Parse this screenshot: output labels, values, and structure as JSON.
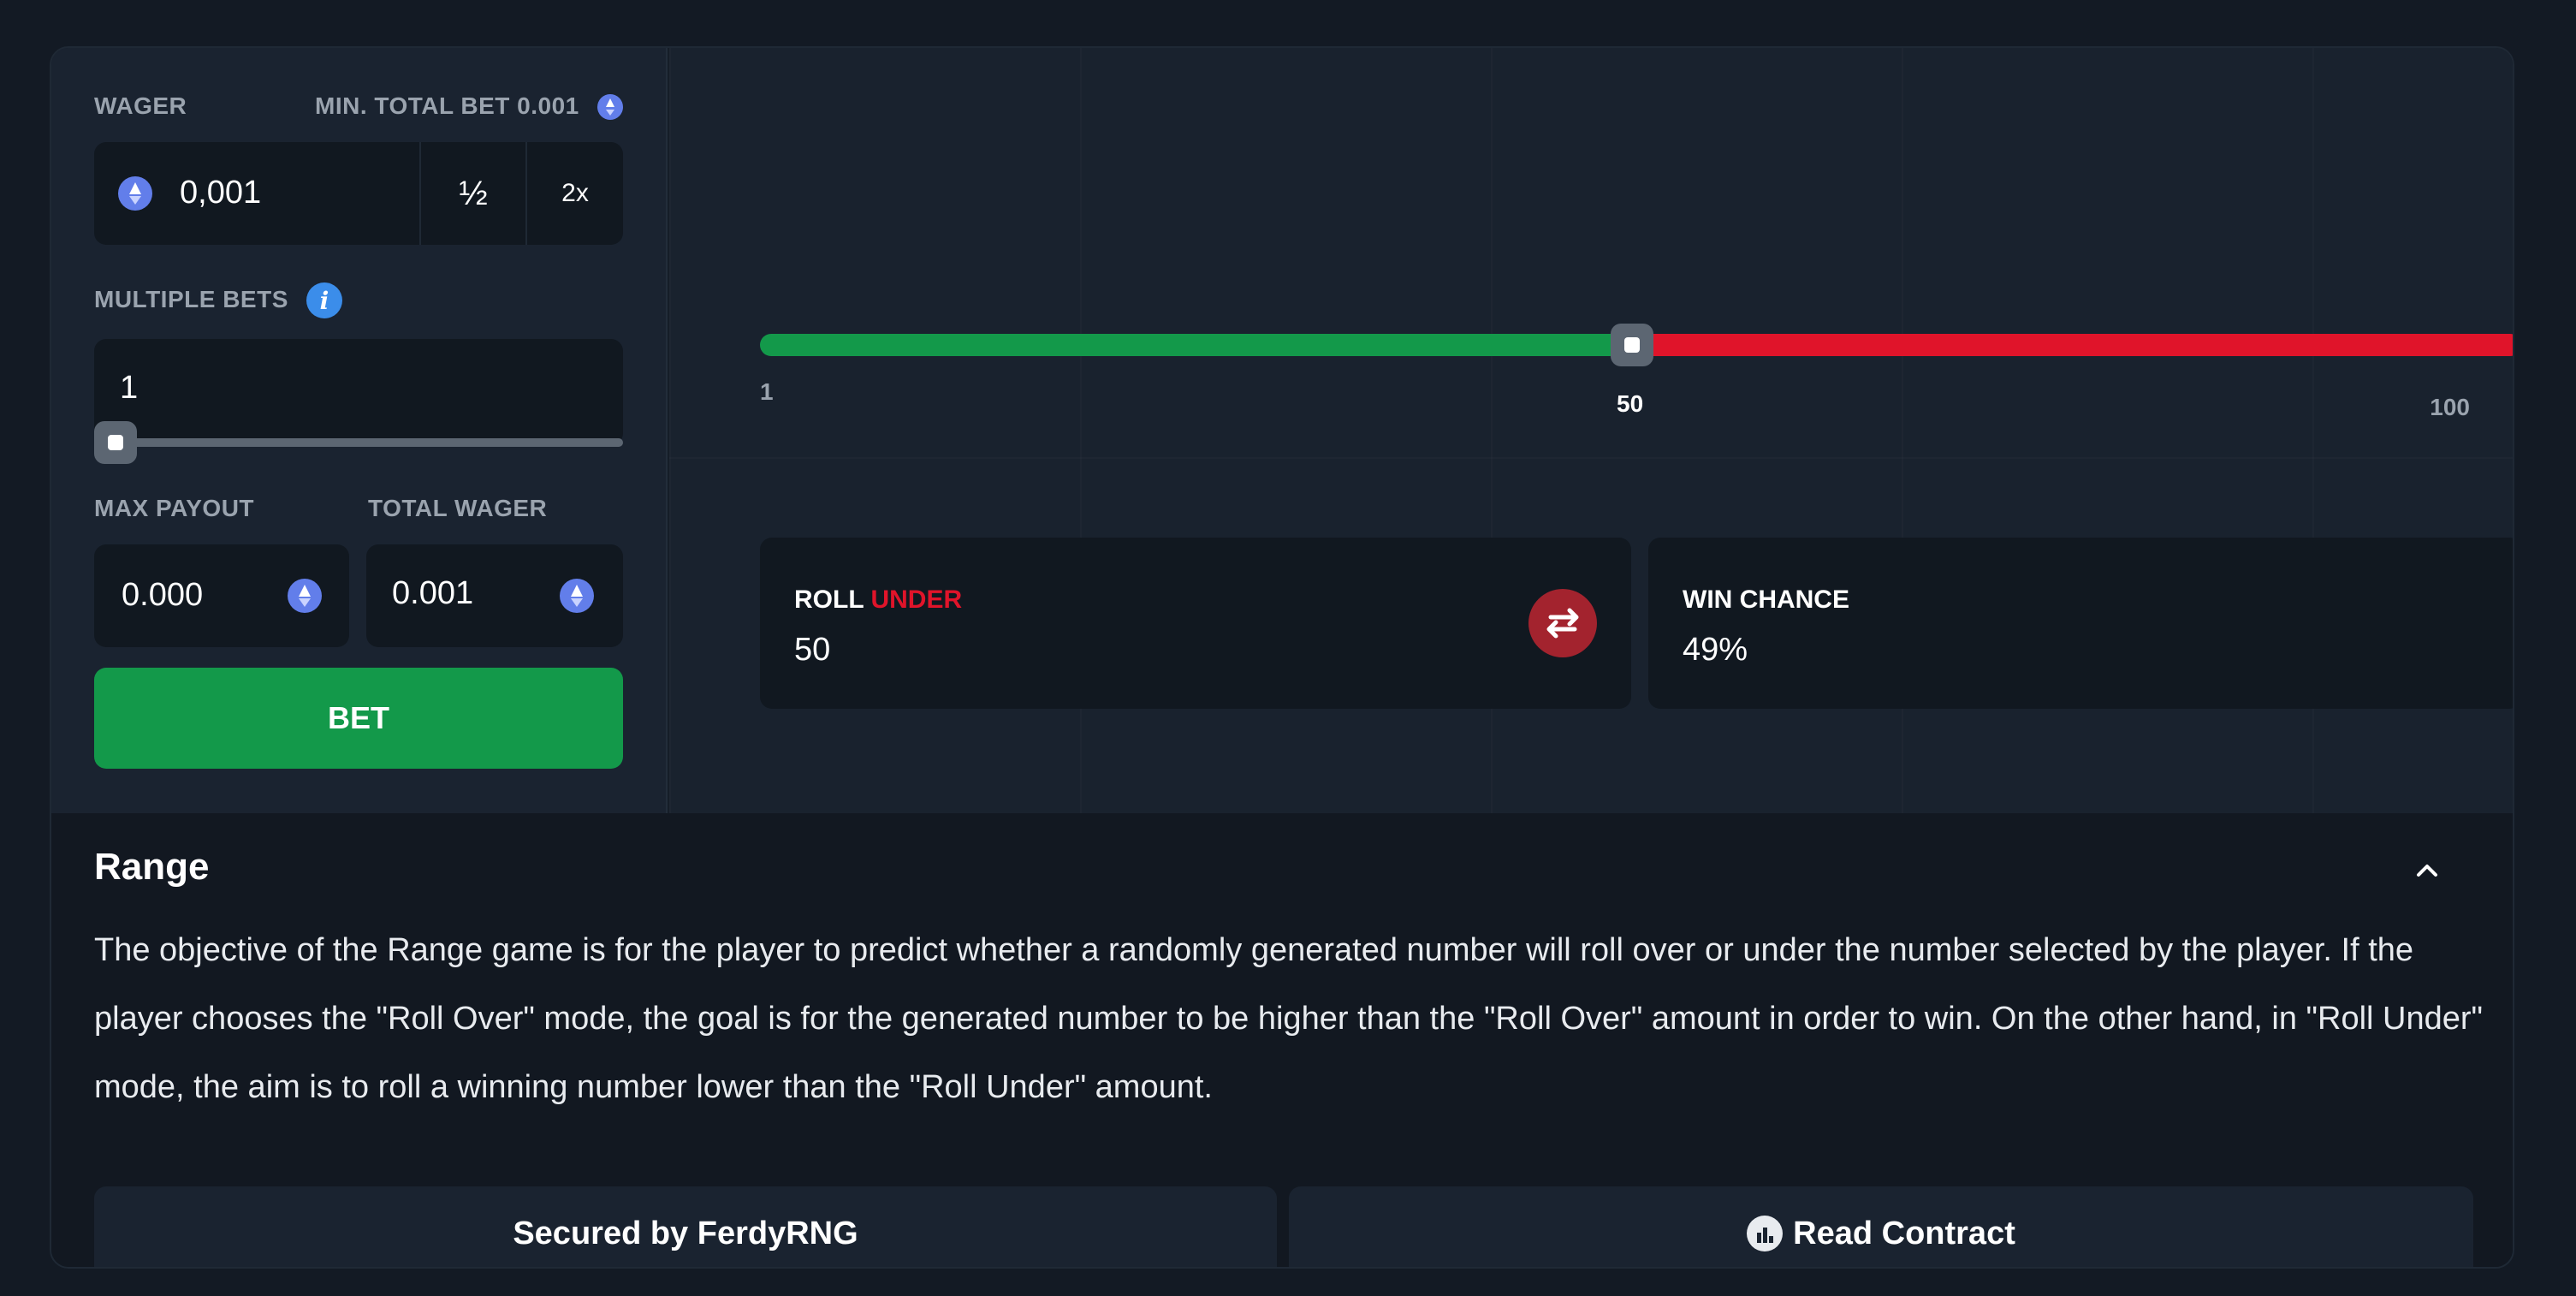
{
  "wager": {
    "label": "WAGER",
    "min_total_bet_label": "MIN. TOTAL BET 0.001",
    "value": "0,001",
    "half_label": "½",
    "double_label": "2x"
  },
  "multiple_bets": {
    "label": "MULTIPLE BETS",
    "value": "1",
    "slider_level": 0
  },
  "max_payout": {
    "label": "MAX PAYOUT",
    "value": "0.000"
  },
  "total_wager": {
    "label": "TOTAL WAGER",
    "value": "0.001"
  },
  "bet_button": {
    "label": "BET"
  },
  "range_slider": {
    "min_label": "1",
    "value_label": "50",
    "max_label": "100",
    "value": 50,
    "min": 1,
    "max": 100
  },
  "roll_card": {
    "prefix": "ROLL",
    "mode": "UNDER",
    "value": "50"
  },
  "win_chance_card": {
    "label": "WIN CHANCE",
    "value": "49%"
  },
  "info": {
    "title": "Range",
    "description": "The objective of the Range game is for the player to predict whether a randomly generated number will roll over or under the number selected by the player. If the player chooses the \"Roll Over\" mode, the goal is for the generated number to be higher than the \"Roll Over\" amount in order to win. On the other hand, in \"Roll Under\" mode, the aim is to roll a winning number lower than the \"Roll Under\" amount."
  },
  "footer": {
    "secured_label": "Secured by FerdyRNG",
    "contract_label": "Read Contract"
  },
  "colors": {
    "accent_green": "#13994a",
    "accent_red": "#e0142a",
    "eth_blue": "#627eea",
    "info_blue": "#3b8dea"
  },
  "icons": {
    "eth": "eth-icon",
    "info": "info-icon",
    "swap": "swap-arrows-icon",
    "chevron": "chevron-up-icon",
    "contract": "contract-chart-icon"
  }
}
